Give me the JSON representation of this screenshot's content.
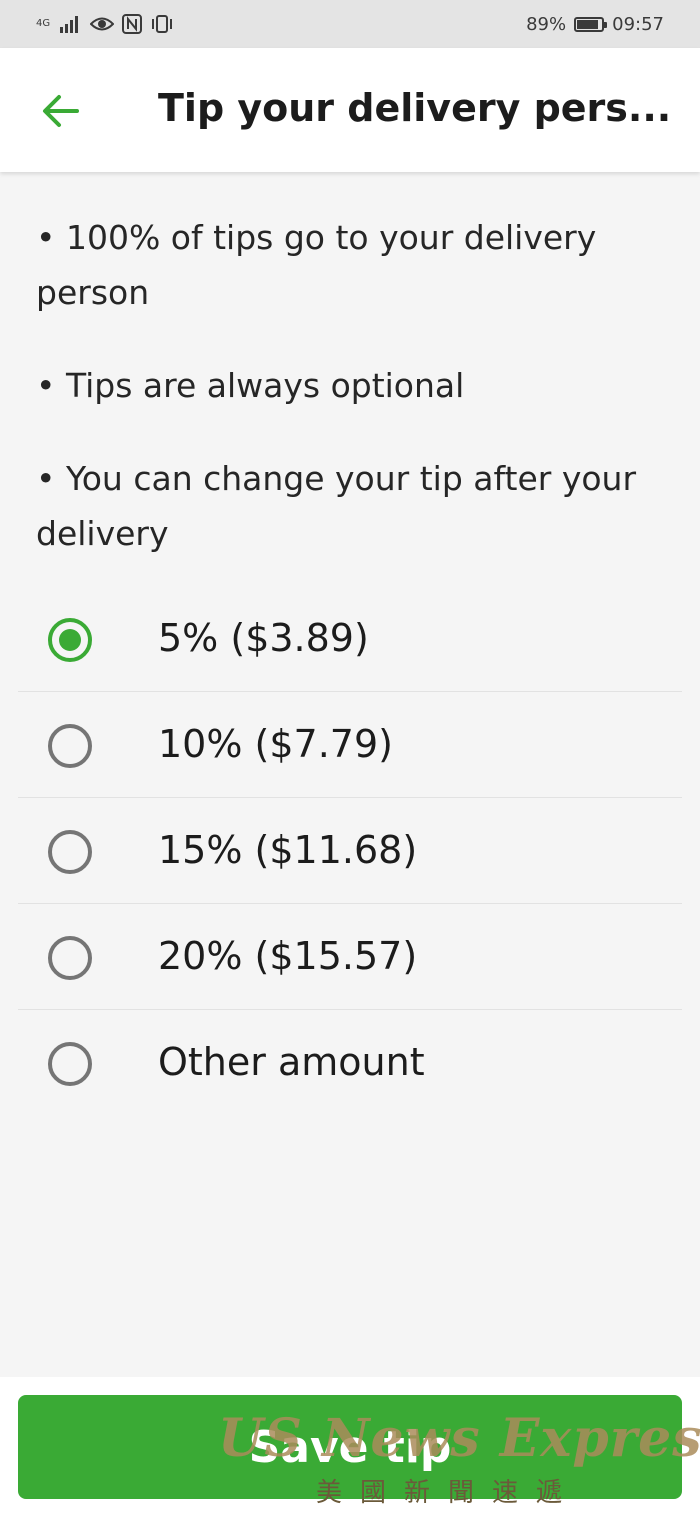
{
  "status_bar": {
    "network": "4G",
    "battery": "89%",
    "battery_level": 0.89,
    "time": "09:57"
  },
  "header": {
    "title": "Tip your delivery pers..."
  },
  "info": [
    "• 100% of tips go to your delivery person",
    "• Tips are always optional",
    "• You can change your tip after your delivery"
  ],
  "tip_options": [
    {
      "label": "5% ($3.89)",
      "selected": true
    },
    {
      "label": "10% ($7.79)",
      "selected": false
    },
    {
      "label": "15% ($11.68)",
      "selected": false
    },
    {
      "label": "20% ($15.57)",
      "selected": false
    },
    {
      "label": "Other amount",
      "selected": false
    }
  ],
  "footer": {
    "save_label": "Save tip"
  },
  "watermark": {
    "title": "US News Express",
    "subtitle": "美國新聞速遞"
  },
  "colors": {
    "accent": "#3aaa35",
    "background": "#f5f5f5",
    "status_bar": "#e4e4e4"
  },
  "icons": [
    "back-arrow-icon",
    "signal-icon",
    "eye-icon",
    "nfc-icon",
    "vibrate-icon",
    "battery-icon"
  ]
}
